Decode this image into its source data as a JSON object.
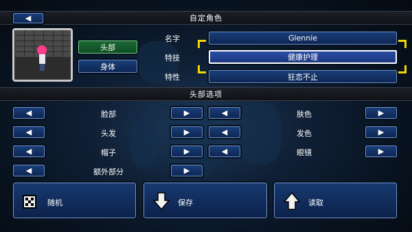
{
  "header": {
    "title": "自定角色",
    "back_icon": "left-arrow-icon"
  },
  "tabs": {
    "head": "头部",
    "body": "身体"
  },
  "info": {
    "name_label": "名字",
    "name_value": "Glennie",
    "trait_label": "特技",
    "trait_value": "健康护理",
    "feature_label": "特性",
    "feature_value": "狂恋不止"
  },
  "head_options": {
    "title": "头部选项",
    "left_rows": [
      "脸部",
      "头发",
      "帽子",
      "额外部分"
    ],
    "right_rows": [
      "肤色",
      "发色",
      "眼镜"
    ]
  },
  "actions": {
    "random": "随机",
    "save": "保存",
    "load": "读取"
  },
  "colors": {
    "accent_green": "#1c6a35",
    "button_blue": "#1a3f7a",
    "selector_yellow": "#f0d800"
  }
}
